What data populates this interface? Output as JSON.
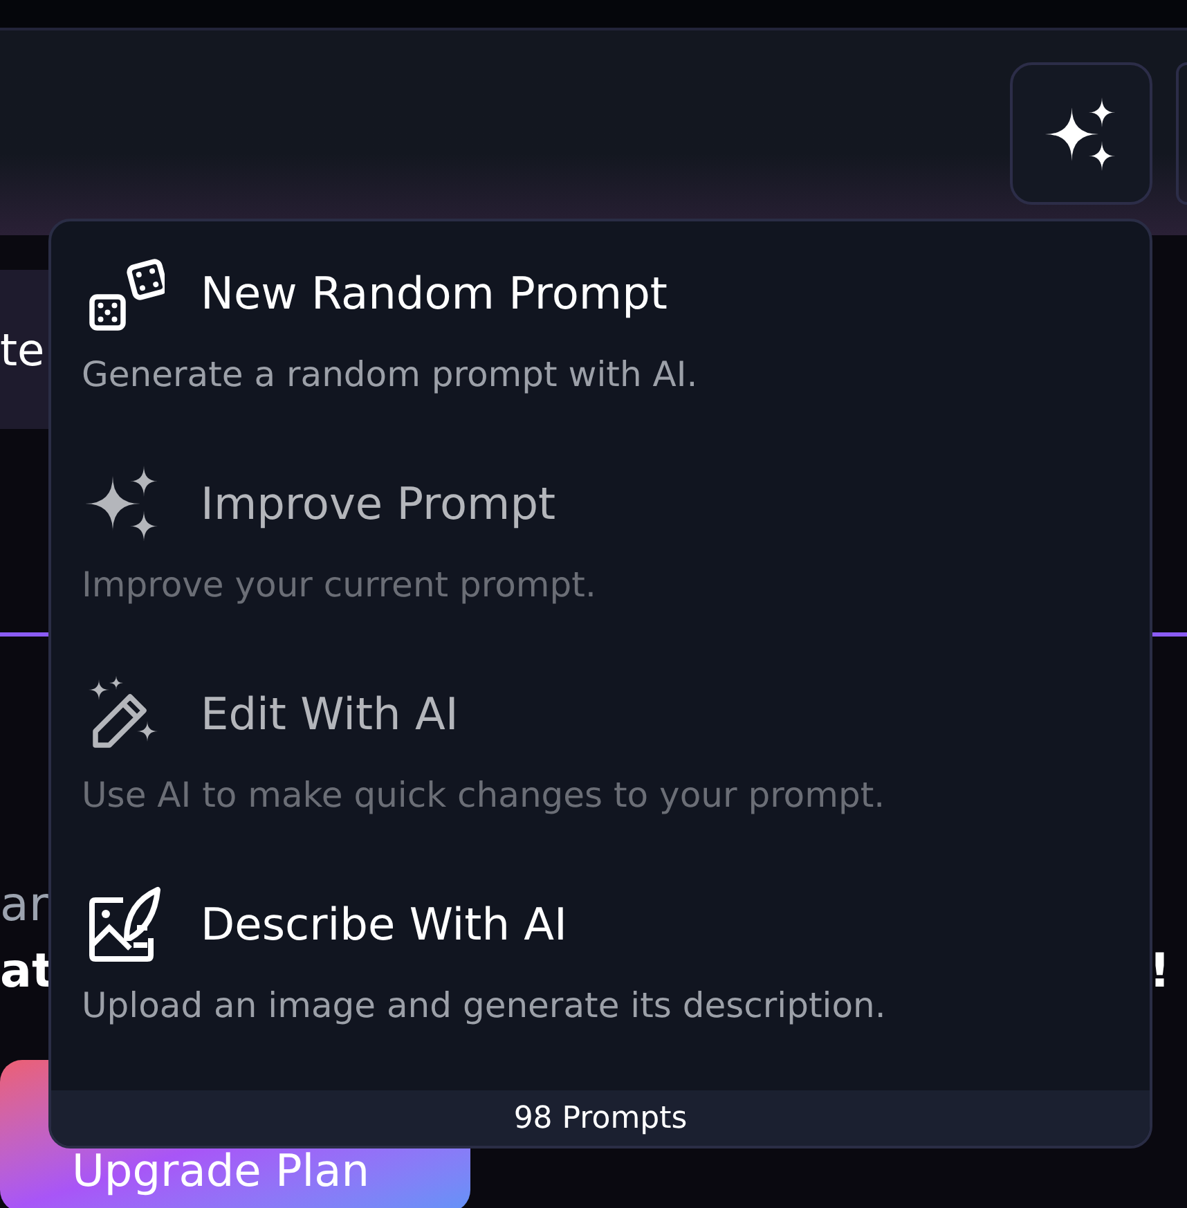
{
  "background": {
    "tab_fragment": "te",
    "text_fragment_1": "ar",
    "text_fragment_2": "at",
    "text_fragment_3": "!",
    "upgrade_button": "Upgrade Plan"
  },
  "menu": {
    "items": [
      {
        "title": "New Random Prompt",
        "description": "Generate a random prompt with AI.",
        "disabled": false
      },
      {
        "title": "Improve Prompt",
        "description": "Improve your current prompt.",
        "disabled": true
      },
      {
        "title": "Edit With AI",
        "description": "Use AI to make quick changes to your prompt.",
        "disabled": true
      },
      {
        "title": "Describe With AI",
        "description": "Upload an image and generate its description.",
        "disabled": false
      }
    ],
    "footer": "98 Prompts"
  }
}
